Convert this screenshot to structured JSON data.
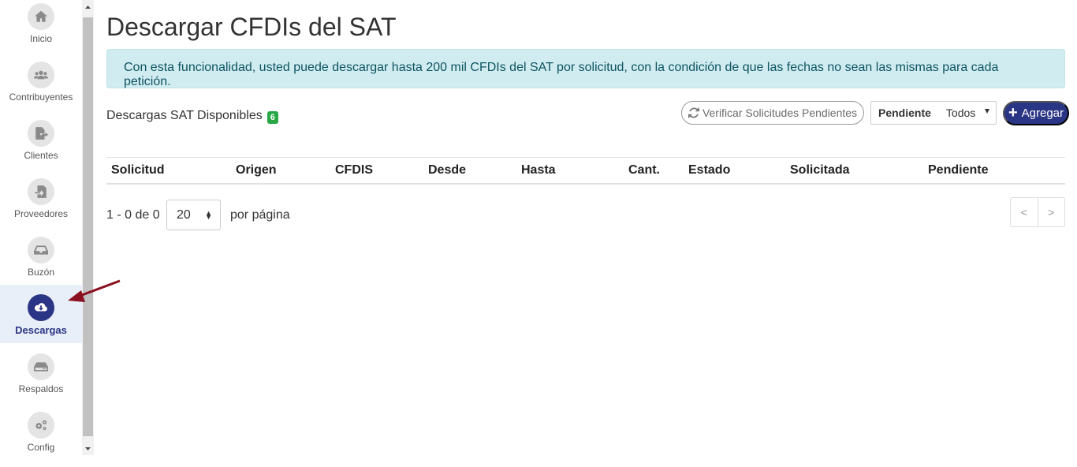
{
  "sidebar": {
    "items": [
      {
        "label": "Inicio",
        "icon": "home-icon"
      },
      {
        "label": "Contribuyentes",
        "icon": "users-icon"
      },
      {
        "label": "Clientes",
        "icon": "file-export-icon"
      },
      {
        "label": "Proveedores",
        "icon": "file-import-icon"
      },
      {
        "label": "Buzón",
        "icon": "inbox-icon"
      },
      {
        "label": "Descargas",
        "icon": "cloud-download-icon",
        "active": true
      },
      {
        "label": "Respaldos",
        "icon": "hdd-icon"
      },
      {
        "label": "Config",
        "icon": "cogs-icon"
      }
    ]
  },
  "main": {
    "title": "Descargar CFDIs del SAT",
    "alert": "Con esta funcionalidad, usted puede descargar hasta 200 mil CFDIs del SAT por solicitud, con la condición de que las fechas no sean las mismas para cada petición.",
    "available_label": "Descargas SAT Disponibles",
    "available_count": "6",
    "verify_button": "Verificar Solicitudes Pendientes",
    "filter_label": "Pendiente",
    "filter_value": "Todos",
    "add_button": "Agregar"
  },
  "table": {
    "columns": [
      "Solicitud",
      "Origen",
      "CFDIS",
      "Desde",
      "Hasta",
      "Cant.",
      "Estado",
      "Solicitada",
      "Pendiente"
    ],
    "rows": []
  },
  "pagination": {
    "range": "1 - 0 de 0",
    "per_page": "20",
    "per_page_label": "por página",
    "prev": "<",
    "next": ">"
  },
  "colors": {
    "accent": "#2b3585",
    "alert_bg": "#d1ecf1",
    "badge": "#28a745",
    "annotation_arrow": "#8b0f1f"
  }
}
